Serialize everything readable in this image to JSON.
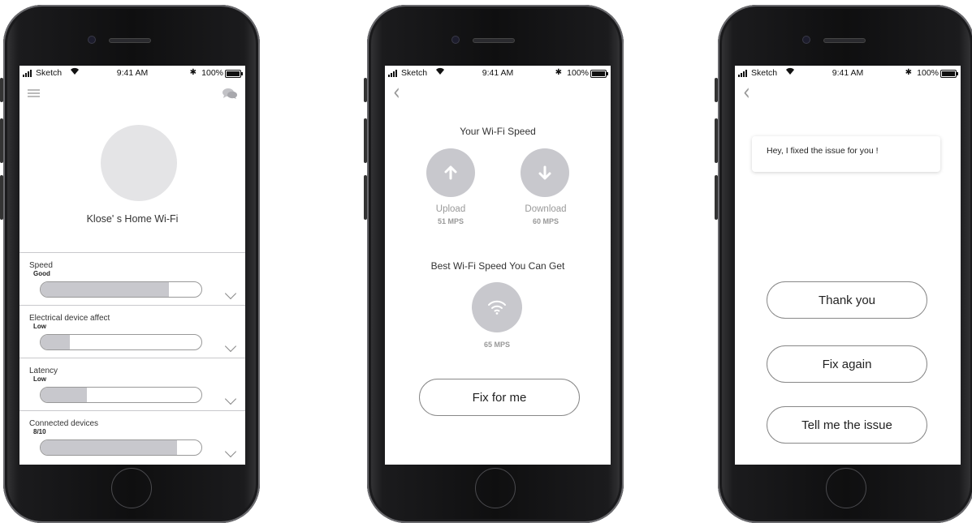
{
  "status_bar": {
    "carrier": "Sketch",
    "time": "9:41 AM",
    "bluetooth": "✱",
    "battery": "100%"
  },
  "screen1": {
    "network_name": "Klose' s Home Wi-Fi",
    "metrics": [
      {
        "label": "Speed",
        "value": "Good",
        "level": 0.8
      },
      {
        "label": "Electrical device affect",
        "value": "Low",
        "level": 0.18
      },
      {
        "label": "Latency",
        "value": "Low",
        "level": 0.29
      },
      {
        "label": "Connected devices",
        "value": "8/10",
        "level": 0.85
      }
    ]
  },
  "screen2": {
    "title": "Your Wi-Fi Speed",
    "upload_label": "Upload",
    "upload_value": "51 MPS",
    "download_label": "Download",
    "download_value": "60 MPS",
    "best_title": "Best Wi-Fi Speed You Can Get",
    "best_value": "65 MPS",
    "fix_button": "Fix for me"
  },
  "screen3": {
    "message": "Hey, I fixed the issue for you !",
    "buttons": [
      "Thank you",
      "Fix again",
      "Tell me the issue"
    ]
  },
  "icons": [
    "menu-icon",
    "chat-icon",
    "back-icon",
    "upload-arrow-icon",
    "download-arrow-icon",
    "wifi-icon",
    "chevron-down-icon",
    "signal-icon",
    "battery-icon"
  ]
}
